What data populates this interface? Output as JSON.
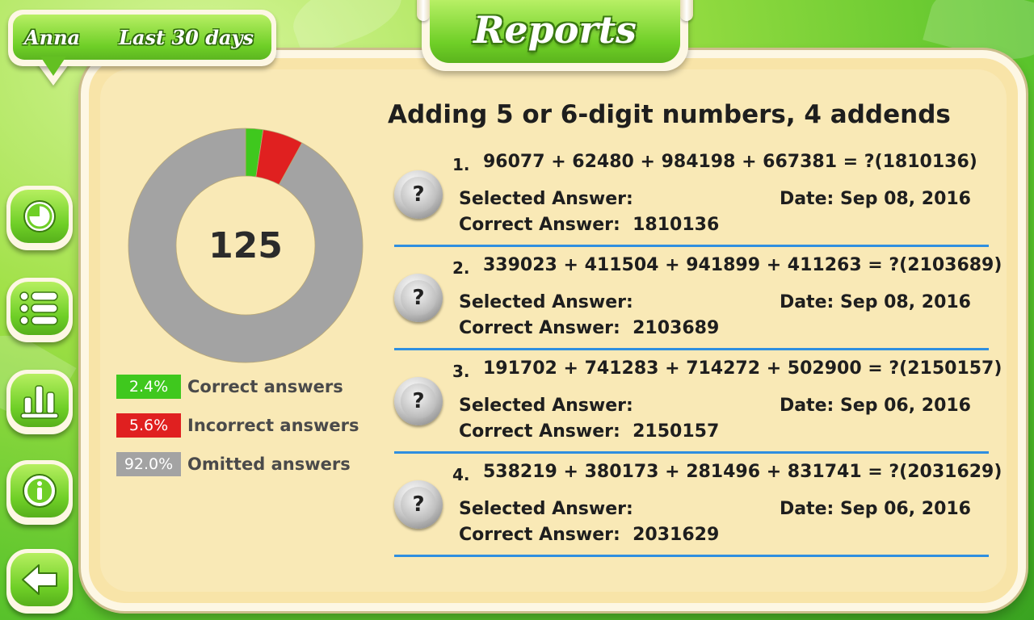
{
  "header": {
    "user_name": "Anna",
    "period": "Last 30 days",
    "title": "Reports"
  },
  "nav": [
    {
      "name": "time-icon"
    },
    {
      "name": "list-icon"
    },
    {
      "name": "bar-chart-icon"
    },
    {
      "name": "info-icon"
    },
    {
      "name": "back-arrow-icon"
    }
  ],
  "summary": {
    "total": "125",
    "legend": [
      {
        "pct": "2.4%",
        "label": "Correct answers",
        "color": "#3fc81e"
      },
      {
        "pct": "5.6%",
        "label": "Incorrect answers",
        "color": "#e02020"
      },
      {
        "pct": "92.0%",
        "label": "Omitted answers",
        "color": "#a3a3a3"
      }
    ]
  },
  "chart_data": {
    "type": "pie",
    "categories": [
      "Correct answers",
      "Incorrect answers",
      "Omitted answers"
    ],
    "values": [
      2.4,
      5.6,
      92.0
    ],
    "colors": [
      "#3fc81e",
      "#e02020",
      "#a3a3a3"
    ]
  },
  "topic": "Adding 5 or 6-digit numbers, 4 addends",
  "labels": {
    "selected": "Selected Answer:",
    "correct": "Correct Answer:"
  },
  "questions": [
    {
      "num": "1.",
      "text": "96077 + 62480 + 984198 + 667381 = ?(1810136)",
      "date": "Date: Sep 08, 2016",
      "correct": "1810136"
    },
    {
      "num": "2.",
      "text": "339023 + 411504 + 941899 + 411263 = ?(2103689)",
      "date": "Date: Sep 08, 2016",
      "correct": "2103689"
    },
    {
      "num": "3.",
      "text": "191702 + 741283 + 714272 + 502900 = ?(2150157)",
      "date": "Date: Sep 06, 2016",
      "correct": "2150157"
    },
    {
      "num": "4.",
      "text": "538219 + 380173 + 281496 + 831741 = ?(2031629)",
      "date": "Date: Sep 06, 2016",
      "correct": "2031629"
    }
  ],
  "question_icon": "?"
}
